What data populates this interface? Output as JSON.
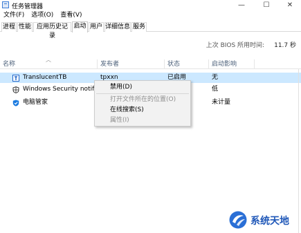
{
  "window": {
    "title": "任务管理器",
    "controls": {
      "minimize": "—",
      "maximize": "☐",
      "close": "✕"
    }
  },
  "menu": [
    "文件(F)",
    "选项(O)",
    "查看(V)"
  ],
  "tabs": [
    {
      "label": "进程",
      "active": false
    },
    {
      "label": "性能",
      "active": false
    },
    {
      "label": "应用历史记录",
      "active": false
    },
    {
      "label": "启动",
      "active": true
    },
    {
      "label": "用户",
      "active": false
    },
    {
      "label": "详细信息",
      "active": false
    },
    {
      "label": "服务",
      "active": false
    }
  ],
  "bios": {
    "label": "上次 BIOS 所用时间:",
    "value": "11.7 秒"
  },
  "columns": {
    "name": "名称",
    "publisher": "发布者",
    "status": "状态",
    "impact": "启动影响"
  },
  "rows": [
    {
      "name": "TranslucentTB",
      "publisher": "tpxxn",
      "status": "已启用",
      "impact": "无",
      "icon": "translucenttb-icon",
      "selected": true
    },
    {
      "name": "Windows Security notifica...",
      "publisher": "",
      "status": "",
      "impact": "低",
      "icon": "windows-security-shield-icon",
      "selected": false
    },
    {
      "name": "电脑管家",
      "publisher": "",
      "status": "",
      "impact": "未计量",
      "icon": "pc-manager-shield-icon",
      "selected": false
    }
  ],
  "context_menu": {
    "items": [
      {
        "label": "禁用(D)",
        "enabled": true
      },
      {
        "label": "打开文件所在的位置(O)",
        "enabled": false
      },
      {
        "label": "在线搜索(S)",
        "enabled": true
      },
      {
        "label": "属性(I)",
        "enabled": false
      }
    ]
  },
  "watermark": {
    "text": "系统天地"
  },
  "colors": {
    "selected_row": "#cce8ff",
    "header_text": "#4c607a",
    "brand_blue": "#1f57b8"
  }
}
